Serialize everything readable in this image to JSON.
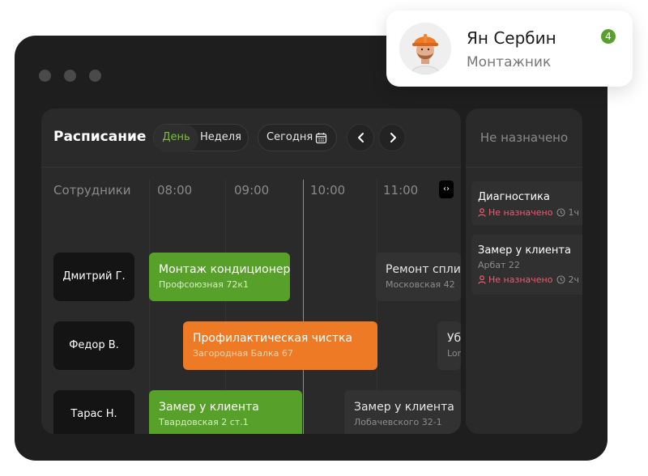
{
  "window": {
    "controls": [
      "close",
      "minimize",
      "maximize"
    ]
  },
  "schedule": {
    "title": "Расписание",
    "view_day": "День",
    "view_week": "Неделя",
    "today": "Сегодня",
    "employees_header": "Сотрудники",
    "time_slots": [
      "08:00",
      "09:00",
      "10:00",
      "11:00"
    ],
    "expand_label": "‹›",
    "employees": [
      "Дмитрий Г.",
      "Федор В.",
      "Тарас Н."
    ],
    "tasks": [
      {
        "title": "Монтаж кондиционера",
        "address": "Профсоюзная 72к1",
        "status": "green"
      },
      {
        "title": "Ремонт сплит",
        "address": "Московская 42",
        "status": "grey"
      },
      {
        "title": "Профилактическая чистка",
        "address": "Загородная Балка 67",
        "status": "orange"
      },
      {
        "title": "Уб",
        "address": "Lor",
        "status": "grey"
      },
      {
        "title": "Замер у клиента",
        "address": "Твардовская 2 ст.1",
        "status": "green"
      },
      {
        "title": "Замер у клиента",
        "address": "Лобачевского 32-1",
        "status": "grey"
      }
    ]
  },
  "unassigned": {
    "title": "Не назначено",
    "items": [
      {
        "title": "Диагностика",
        "address": "",
        "status": "Не назначено",
        "duration": "1ч"
      },
      {
        "title": "Замер у клиента",
        "address": "Арбат 22",
        "status": "Не назначено",
        "duration": "2ч"
      }
    ]
  },
  "profile": {
    "name": "Ян Сербин",
    "role": "Монтажник",
    "badge": "4"
  },
  "colors": {
    "accent_green": "#57a12b",
    "accent_orange": "#ee7a26",
    "status_red": "#ef5a6f",
    "window_bg": "#1e1e1e"
  },
  "icons": [
    "calendar-icon",
    "chevron-left-icon",
    "chevron-right-icon",
    "user-icon",
    "clock-icon",
    "expand-icon"
  ]
}
